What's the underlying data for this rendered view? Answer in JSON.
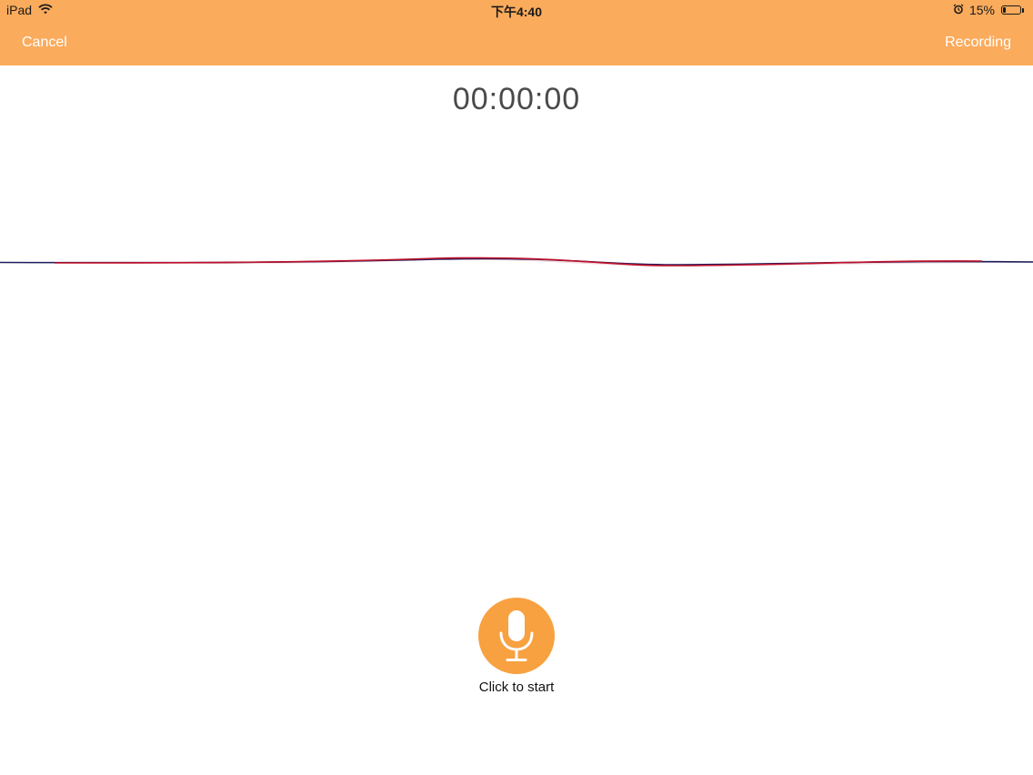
{
  "status_bar": {
    "device": "iPad",
    "time": "下午4:40",
    "battery_text": "15%",
    "battery_level": 0.15,
    "icons": [
      "wifi-icon",
      "alarm-icon",
      "battery-icon"
    ]
  },
  "nav": {
    "cancel_label": "Cancel",
    "title_label": "Recording"
  },
  "recorder": {
    "timer": "00:00:00",
    "start_hint": "Click to start",
    "button_icon": "microphone-icon"
  },
  "colors": {
    "header": "#fbab5c",
    "record_button": "#f8a141",
    "wave_primary": "#c0102a",
    "wave_secondary": "#1b1f5e"
  }
}
